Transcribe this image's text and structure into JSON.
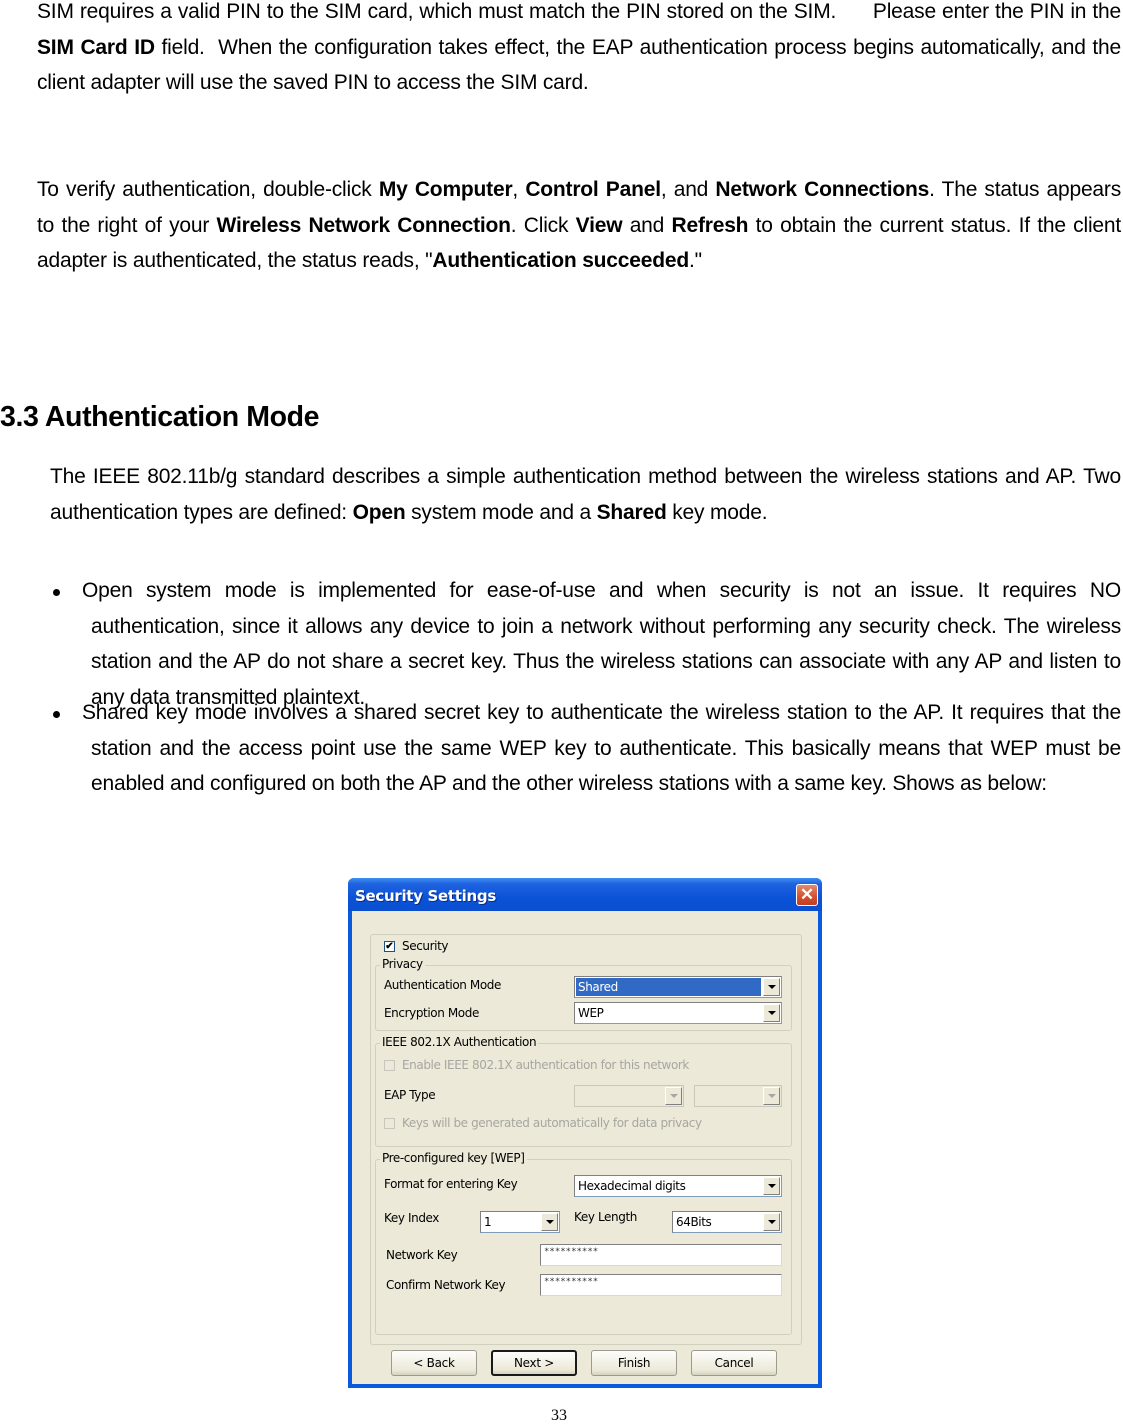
{
  "paragraph1": {
    "t1": "SIM requires a valid PIN to the SIM card, which must match the PIN stored on the SIM.      Please enter the PIN in the ",
    "b1": "SIM Card ID",
    "t2": " field.  When the configuration takes effect, the EAP authentication process begins automatically, and the client adapter will use the saved PIN to access the SIM card."
  },
  "paragraph2": {
    "t1": "To verify authentication, double-click ",
    "b1": "My Computer",
    "t2": ", ",
    "b2": "Control Panel",
    "t3": ", and ",
    "b3": "Network Connections",
    "t4": ". The status appears to the right of your ",
    "b4": "Wireless Network Connection",
    "t5": ". Click ",
    "b5": "View",
    "t6": " and ",
    "b6": "Refresh",
    "t7": " to obtain the current status. If the client adapter is authenticated, the status reads, \"",
    "b7": "Authentication succeeded",
    "t8": ".\""
  },
  "section_heading": "3.3 Authentication Mode",
  "paragraph3": {
    "t1": "The IEEE 802.11b/g standard describes a simple authentication method between the wireless stations and AP. Two authentication types are defined: ",
    "b1": "Open",
    "t2": " system mode and a ",
    "b2": "Shared",
    "t3": " key mode."
  },
  "bullets": [
    "Open system mode is implemented for ease-of-use and when security is not an issue. It requires NO authentication, since it allows any device to join a network without performing any security check. The wireless station and the AP do not share a secret key. Thus the wireless stations can associate with any AP and listen to any data transmitted plaintext.",
    "Shared key mode involves a shared secret key to authenticate the wireless station to the AP. It requires that the station and the access point use the same WEP key to authenticate. This basically means that WEP must be enabled and configured on both the AP and the other wireless stations with a same key. Shows as below:"
  ],
  "dialog": {
    "title": "Security Settings",
    "close_icon": "✕",
    "security_checkbox": {
      "label": "Security",
      "checked": true,
      "mark": "✔"
    },
    "privacy": {
      "legend": "Privacy",
      "auth_mode_label": "Authentication Mode",
      "auth_mode_value": "Shared",
      "encryption_label": "Encryption Mode",
      "encryption_value": "WEP"
    },
    "ieee8021x": {
      "legend": "IEEE 802.1X Authentication",
      "enable_label": "Enable IEEE 802.1X authentication for this network",
      "eap_type_label": "EAP Type",
      "eap_type_value": "",
      "eap_type_value2": "",
      "keys_auto_label": "Keys will be generated automatically for data privacy"
    },
    "wep": {
      "legend": "Pre-configured key [WEP]",
      "format_label": "Format for entering Key",
      "format_value": "Hexadecimal digits",
      "key_index_label": "Key Index",
      "key_index_value": "1",
      "key_length_label": "Key Length",
      "key_length_value": "64Bits",
      "network_key_label": "Network Key",
      "network_key_value": "**********",
      "confirm_key_label": "Confirm Network Key",
      "confirm_key_value": "**********"
    },
    "buttons": {
      "back": "< Back",
      "next": "Next >",
      "finish": "Finish",
      "cancel": "Cancel"
    }
  },
  "page_number": "33"
}
